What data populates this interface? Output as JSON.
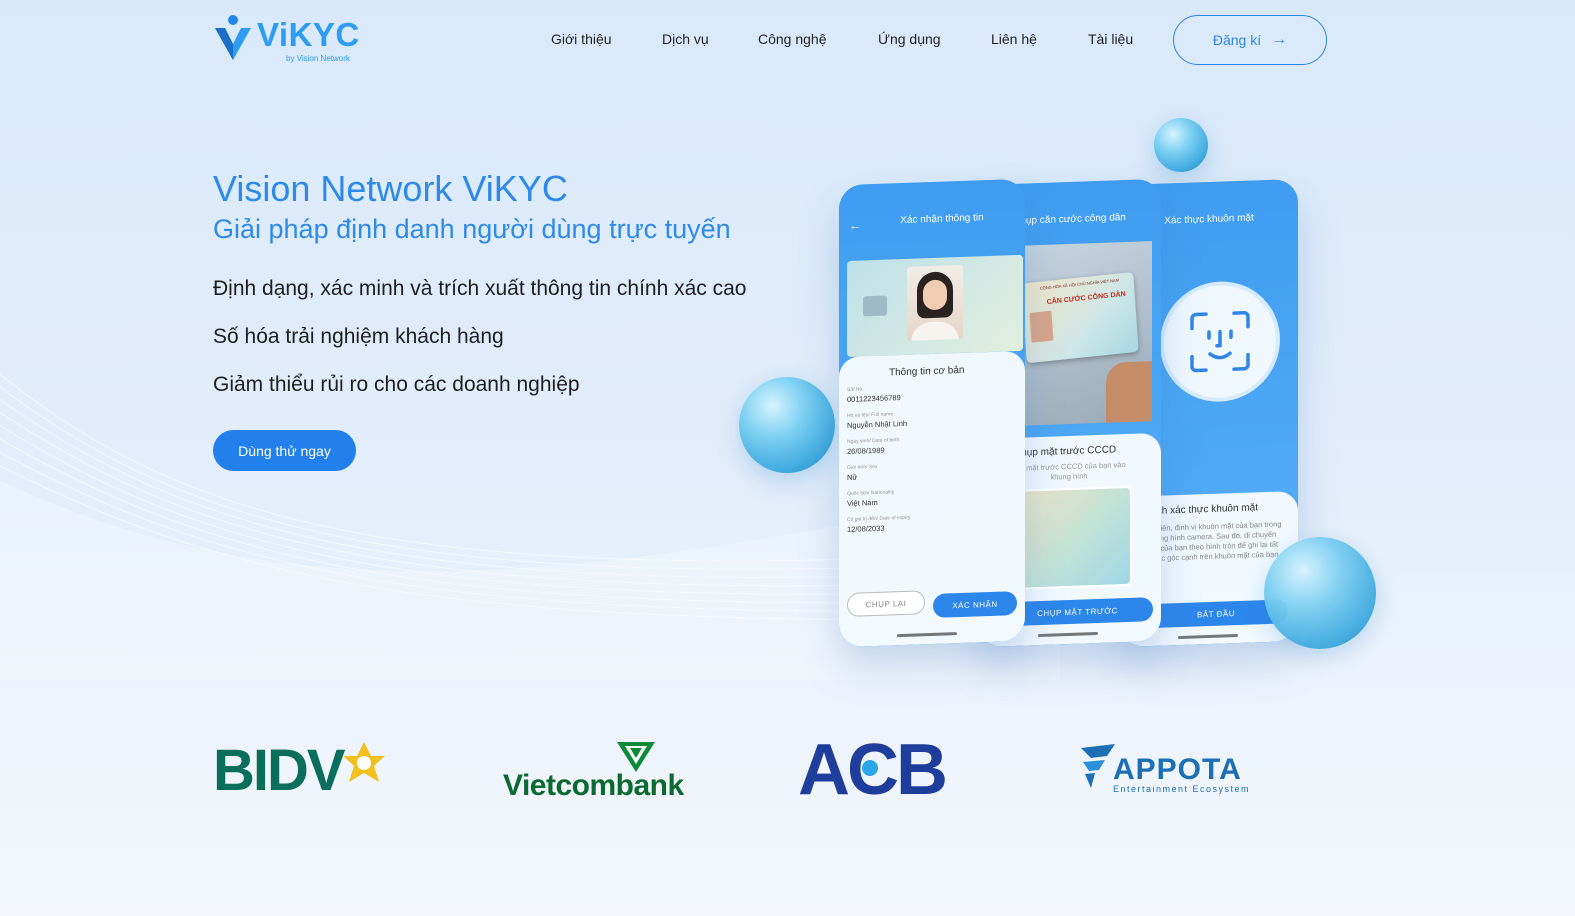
{
  "brand": {
    "logo_text": "ViKYC",
    "logo_sub": "by Vision Network"
  },
  "nav": {
    "items": [
      {
        "label": "Giới thiệu"
      },
      {
        "label": "Dịch vụ"
      },
      {
        "label": "Công nghệ"
      },
      {
        "label": "Ứng dụng"
      },
      {
        "label": "Liên hệ"
      },
      {
        "label": "Tài liệu"
      }
    ],
    "signup_label": "Đăng kí",
    "signup_icon": "arrow-right-icon"
  },
  "hero": {
    "title": "Vision Network ViKYC",
    "subtitle": "Giải pháp định danh người dùng trực tuyến",
    "lines": [
      "Định dạng, xác minh và trích xuất thông tin chính xác cao",
      "Số hóa trải nghiệm khách hàng",
      "Giảm thiểu rủi ro cho các doanh nghiệp"
    ],
    "cta_label": "Dùng thử ngay"
  },
  "phones": {
    "phone1": {
      "header": "Xác nhận thông tin",
      "card_title": "Thông tin cơ bản",
      "fields": [
        {
          "label": "Số/ No.",
          "value": "0011223456789"
        },
        {
          "label": "Họ và tên/ Full name",
          "value": "Nguyễn Nhật Linh"
        },
        {
          "label": "Ngày sinh/ Date of birth",
          "value": "26/08/1989"
        },
        {
          "label": "Giới tính/ Sex",
          "value": "Nữ"
        },
        {
          "label": "Quốc tịch/ Nationality",
          "value": "Việt Nam"
        },
        {
          "label": "Có giá trị đến/ Date of expiry",
          "value": "12/08/2033"
        }
      ],
      "retake_label": "CHỤP LẠI",
      "confirm_label": "XÁC NHẬN"
    },
    "phone2": {
      "header": "Chụp căn cước công dân",
      "card_header": "CỘNG HÒA XÃ HỘI CHỦ NGHĨA VIỆT NAM",
      "card_title": "CĂN CƯỚC CÔNG DÂN",
      "panel_title": "Chụp mặt trước CCCD",
      "panel_desc": "Đặt mặt trước CCCD của bạn vào khung hình",
      "button_label": "CHỤP MẶT TRƯỚC"
    },
    "phone3": {
      "header": "Xác thực khuôn mặt",
      "panel_title": "Cách xác thực khuôn mặt",
      "panel_desc": "Đầu tiên, định vị khuôn mặt của bạn trong khung hình camera. Sau đó, di chuyển đầu của bạn theo hình tròn để ghi lại tất cả các góc cạnh trên khuôn mặt của bạn.",
      "button_label": "BẮT ĐẦU"
    }
  },
  "partners": {
    "bidv": "BIDV",
    "vietcombank": "Vietcombank",
    "acb": "ACB",
    "appota": "APPOTA",
    "appota_sub": "Entertainment Ecosystem"
  },
  "colors": {
    "accent": "#2e8ae9",
    "button": "#2180ec",
    "bidv_green": "#0a6e5c",
    "vcb_green": "#0b6a2f",
    "acb_blue": "#1f3d9a",
    "appota_blue": "#1c6fb5"
  }
}
